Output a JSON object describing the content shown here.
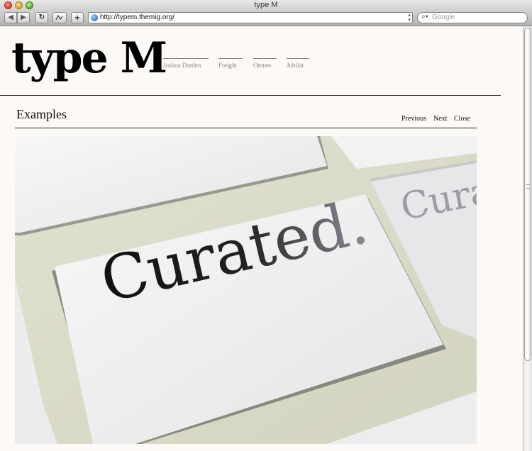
{
  "browser": {
    "window_title": "type M",
    "url": "http://typem.themig.org/",
    "search_placeholder": "Google"
  },
  "site": {
    "logo": "type M",
    "nav": [
      "Joshua Darden",
      "Freight",
      "Omnes",
      "Jubilat"
    ]
  },
  "gallery": {
    "title": "Examples",
    "previous_label": "Previous",
    "next_label": "Next",
    "close_label": "Close",
    "image_text_main": "Curated.",
    "image_text_side": "Curat"
  },
  "colors": {
    "page_bg": "#fcf9f6",
    "rule": "#222222",
    "nav_text": "#888888"
  }
}
